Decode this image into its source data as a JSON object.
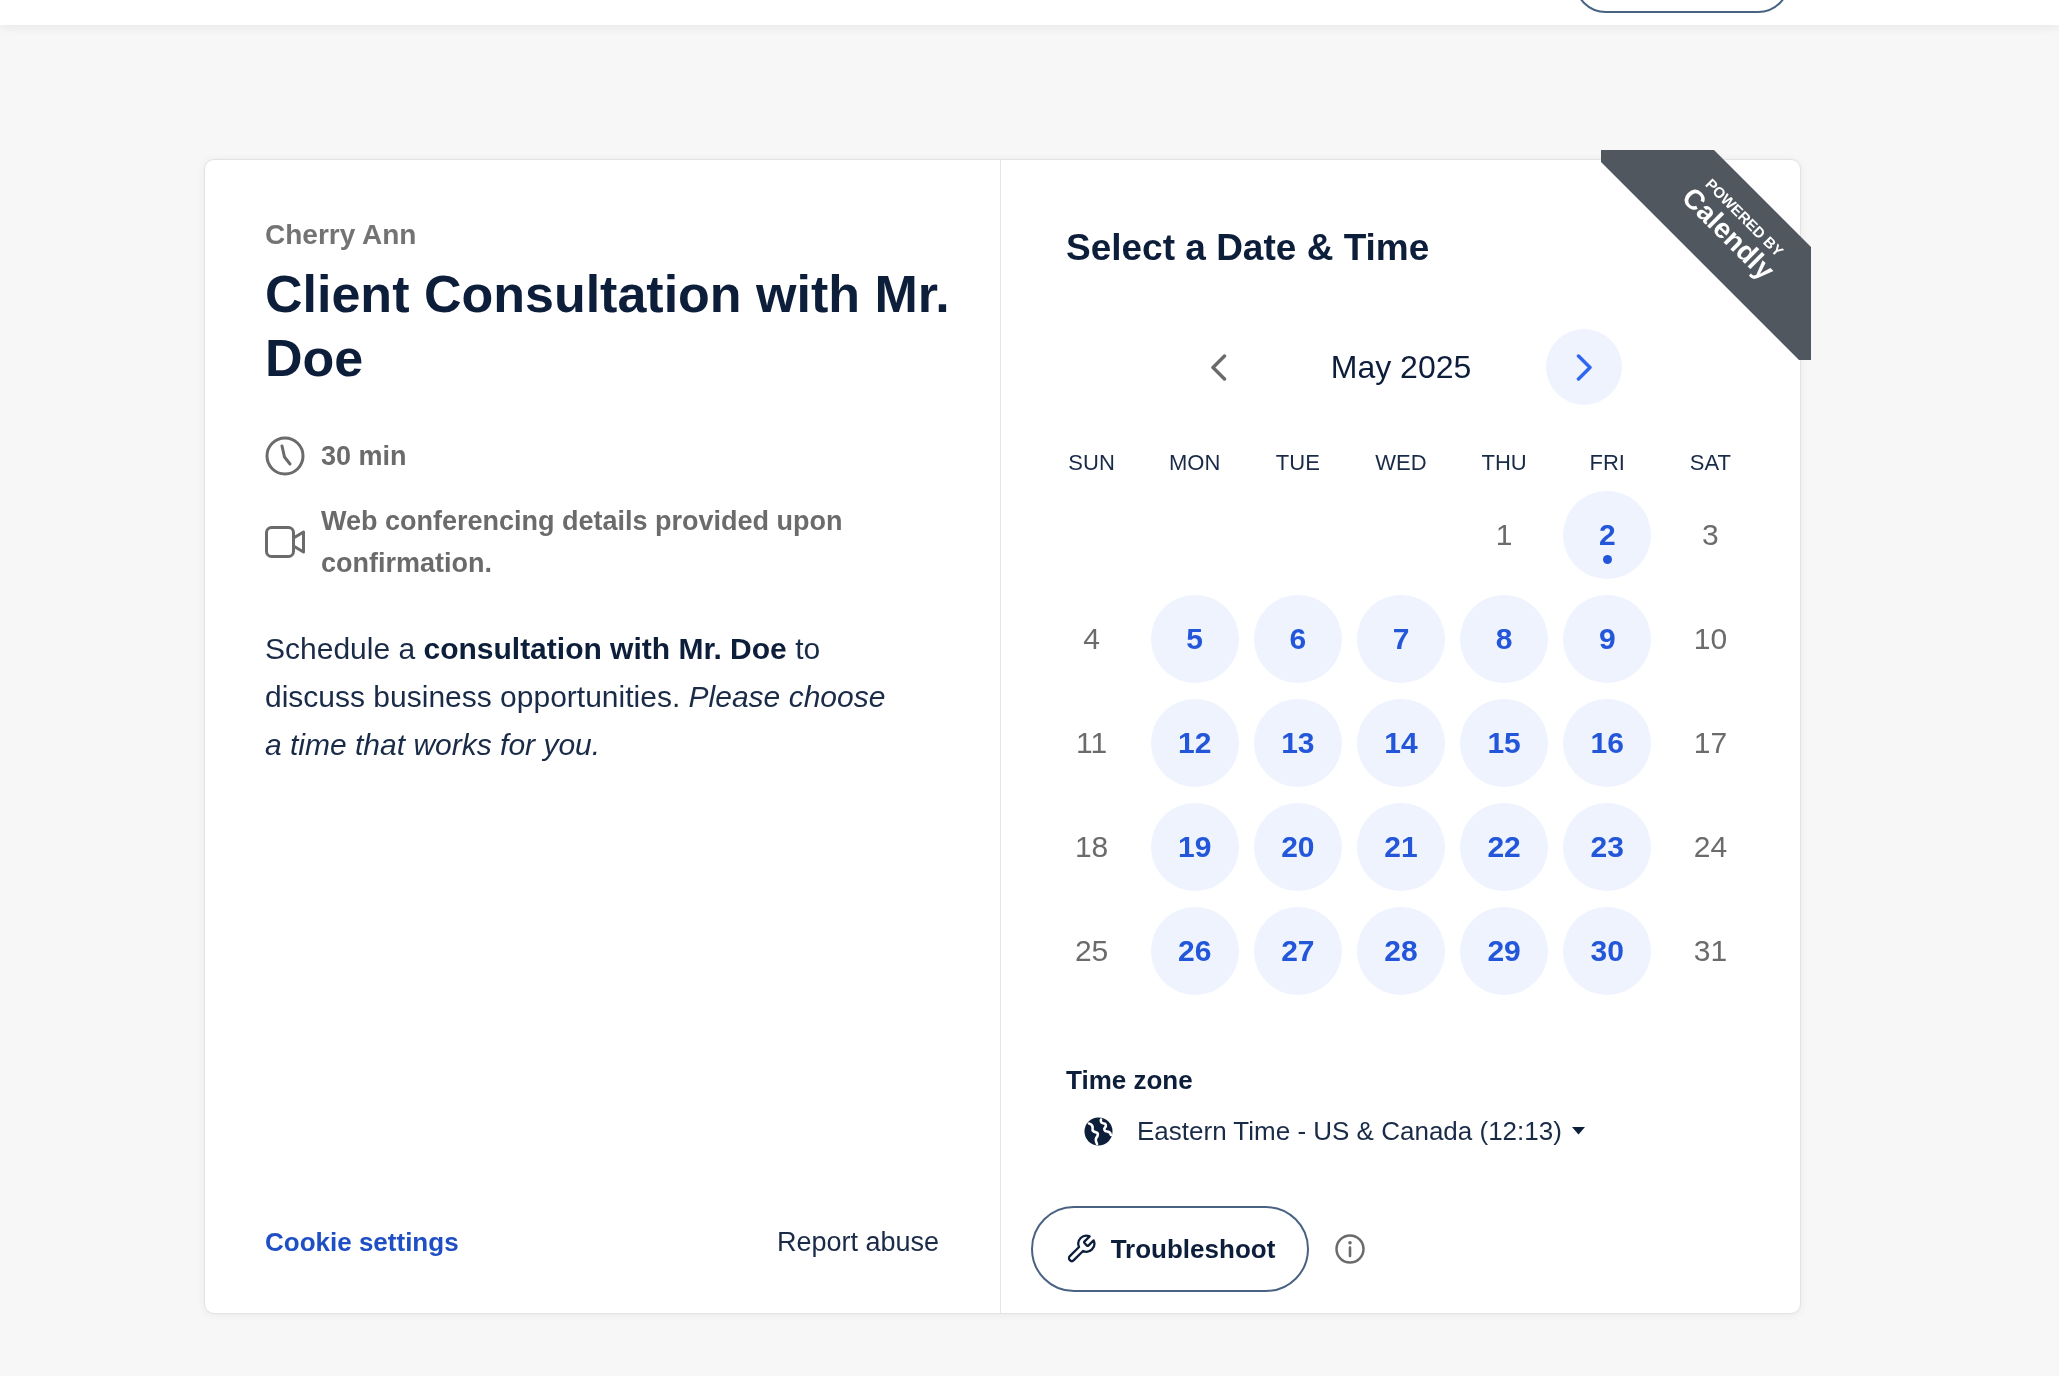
{
  "event": {
    "host": "Cherry Ann",
    "title": "Client Consultation with Mr. Doe",
    "details": [
      {
        "kind": "duration",
        "text": "30 min"
      },
      {
        "kind": "conferencing",
        "text": "Web conferencing details provided upon confirmation."
      }
    ],
    "description": "Schedule a **consultation with Mr. Doe** to discuss business opportunities. *Please choose a time that works for you.*",
    "footer_links": [
      {
        "kind": "accent",
        "text": "Cookie settings"
      },
      {
        "kind": "plain",
        "text": "Report abuse"
      }
    ]
  },
  "scheduler": {
    "title": "Select a Date & Time",
    "calendar": {
      "previous_month": {
        "disabled": true
      },
      "month_label": "May 2025",
      "next_month": {
        "disabled": false
      },
      "weekdays": [
        "SUN",
        "MON",
        "TUE",
        "WED",
        "THU",
        "FRI",
        "SAT"
      ],
      "days": [
        {
          "kind": "blank"
        },
        {
          "kind": "blank"
        },
        {
          "kind": "blank"
        },
        {
          "kind": "blank"
        },
        {
          "kind": "day",
          "label": "1",
          "available": false,
          "today": false,
          "selected": false
        },
        {
          "kind": "day",
          "label": "2",
          "available": true,
          "today": true,
          "selected": false
        },
        {
          "kind": "day",
          "label": "3",
          "available": false,
          "today": false,
          "selected": false
        },
        {
          "kind": "day",
          "label": "4",
          "available": false,
          "today": false,
          "selected": false
        },
        {
          "kind": "day",
          "label": "5",
          "available": true,
          "today": false,
          "selected": false
        },
        {
          "kind": "day",
          "label": "6",
          "available": true,
          "today": false,
          "selected": false
        },
        {
          "kind": "day",
          "label": "7",
          "available": true,
          "today": false,
          "selected": false
        },
        {
          "kind": "day",
          "label": "8",
          "available": true,
          "today": false,
          "selected": false
        },
        {
          "kind": "day",
          "label": "9",
          "available": true,
          "today": false,
          "selected": false
        },
        {
          "kind": "day",
          "label": "10",
          "available": false,
          "today": false,
          "selected": false
        },
        {
          "kind": "day",
          "label": "11",
          "available": false,
          "today": false,
          "selected": false
        },
        {
          "kind": "day",
          "label": "12",
          "available": true,
          "today": false,
          "selected": false
        },
        {
          "kind": "day",
          "label": "13",
          "available": true,
          "today": false,
          "selected": false
        },
        {
          "kind": "day",
          "label": "14",
          "available": true,
          "today": false,
          "selected": false
        },
        {
          "kind": "day",
          "label": "15",
          "available": true,
          "today": false,
          "selected": false
        },
        {
          "kind": "day",
          "label": "16",
          "available": true,
          "today": false,
          "selected": false
        },
        {
          "kind": "day",
          "label": "17",
          "available": false,
          "today": false,
          "selected": false
        },
        {
          "kind": "day",
          "label": "18",
          "available": false,
          "today": false,
          "selected": false
        },
        {
          "kind": "day",
          "label": "19",
          "available": true,
          "today": false,
          "selected": false
        },
        {
          "kind": "day",
          "label": "20",
          "available": true,
          "today": false,
          "selected": false
        },
        {
          "kind": "day",
          "label": "21",
          "available": true,
          "today": false,
          "selected": false
        },
        {
          "kind": "day",
          "label": "22",
          "available": true,
          "today": false,
          "selected": false
        },
        {
          "kind": "day",
          "label": "23",
          "available": true,
          "today": false,
          "selected": false
        },
        {
          "kind": "day",
          "label": "24",
          "available": false,
          "today": false,
          "selected": false
        },
        {
          "kind": "day",
          "label": "25",
          "available": false,
          "today": false,
          "selected": false
        },
        {
          "kind": "day",
          "label": "26",
          "available": true,
          "today": false,
          "selected": false
        },
        {
          "kind": "day",
          "label": "27",
          "available": true,
          "today": false,
          "selected": false
        },
        {
          "kind": "day",
          "label": "28",
          "available": true,
          "today": false,
          "selected": false
        },
        {
          "kind": "day",
          "label": "29",
          "available": true,
          "today": false,
          "selected": false
        },
        {
          "kind": "day",
          "label": "30",
          "available": true,
          "today": false,
          "selected": false
        },
        {
          "kind": "day",
          "label": "31",
          "available": false,
          "today": false,
          "selected": false
        }
      ]
    },
    "time_zone": {
      "label": "Time zone",
      "value": "Eastern Time - US & Canada (12:13)"
    },
    "troubleshoot_button": "Troubleshoot"
  },
  "corner_ribbon": {
    "caption": "POWERED BY",
    "brand": "Calendly"
  }
}
